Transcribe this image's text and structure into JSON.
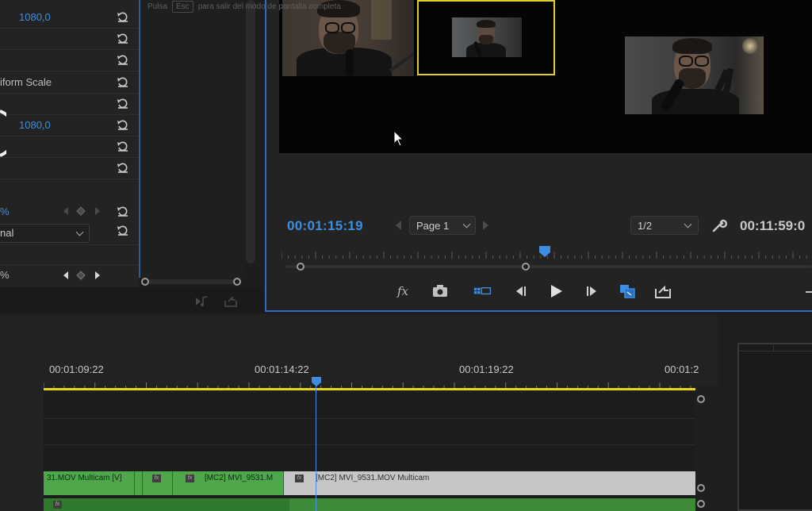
{
  "effect_controls": {
    "rows": [
      {
        "value": "1080,0",
        "value_style": "blue"
      },
      {
        "value": ""
      },
      {
        "value": ""
      },
      {
        "value": "iform Scale",
        "value_style": "gray"
      },
      {
        "value": ""
      },
      {
        "value": "1080,0",
        "value_style": "blue"
      },
      {
        "value": ""
      },
      {
        "value": ""
      }
    ],
    "opacity_value": "%",
    "blend_mode": "nal",
    "speed_value": "%"
  },
  "fullscreen_hint": {
    "prefix": "Pulsa",
    "key": "Esc",
    "suffix": "para salir del modo de pantalla completa"
  },
  "program_monitor": {
    "current_timecode": "00:01:15:19",
    "total_timecode": "00:11:59:0",
    "page_label": "Page 1",
    "resolution": "1/2",
    "playhead_percent": 51
  },
  "timeline": {
    "time_labels": [
      "00:01:09:22",
      "00:01:14:22",
      "00:01:19:22",
      "00:01:2"
    ],
    "clips": [
      {
        "label": "31.MOV Multicam [V]",
        "color": "green",
        "fx": false
      },
      {
        "label": "",
        "color": "green",
        "fx": true
      },
      {
        "label": "[MC2] MVI_9531.M",
        "color": "green",
        "fx": true
      },
      {
        "label": "[MC2] MVI_9531.MOV Multicam",
        "color": "gray",
        "fx": true
      }
    ],
    "fx_label": "fx"
  },
  "colors": {
    "accent_blue": "#3d8ee0",
    "selection_yellow": "#e7d31b",
    "clip_green": "#4fa74c",
    "clip_selected_gray": "#c6c6c6"
  },
  "icons": [
    "reset-icon",
    "keyframe-icon",
    "fx-icon",
    "camera-icon",
    "multicam-icon",
    "step-back-icon",
    "play-icon",
    "step-forward-icon",
    "toggle-overlay-icon",
    "export-frame-icon",
    "wrench-icon",
    "mouse-cursor-icon"
  ]
}
